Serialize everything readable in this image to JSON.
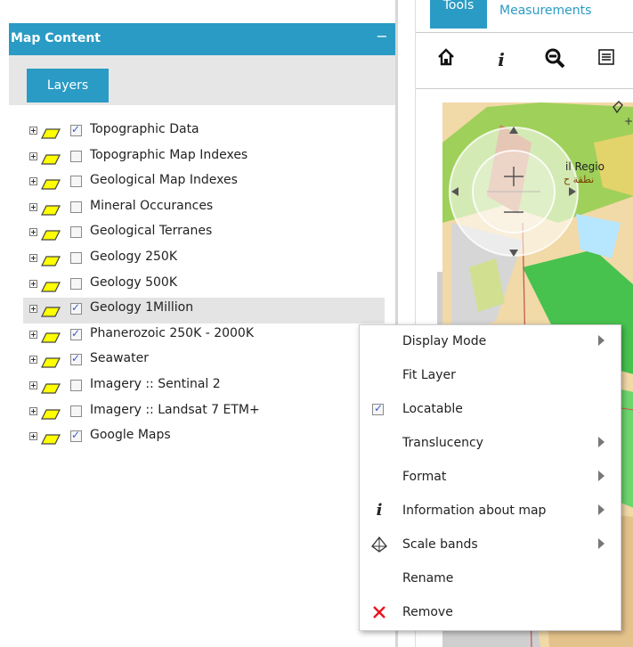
{
  "panel": {
    "title": "Map Content",
    "collapse_symbol": "−",
    "tab_layers": "Layers"
  },
  "layers": [
    {
      "label": "Topographic Data",
      "checked": true
    },
    {
      "label": "Topographic Map Indexes",
      "checked": false
    },
    {
      "label": "Geological Map Indexes",
      "checked": false
    },
    {
      "label": "Mineral Occurances",
      "checked": false
    },
    {
      "label": "Geological Terranes",
      "checked": false
    },
    {
      "label": "Geology 250K",
      "checked": false
    },
    {
      "label": "Geology 500K",
      "checked": false
    },
    {
      "label": "Geology 1Million",
      "checked": true,
      "highlighted": true
    },
    {
      "label": "Phanerozoic 250K - 2000K",
      "checked": true
    },
    {
      "label": "Seawater",
      "checked": true
    },
    {
      "label": "Imagery :: Sentinal 2",
      "checked": false
    },
    {
      "label": "Imagery :: Landsat 7 ETM+",
      "checked": false
    },
    {
      "label": "Google Maps",
      "checked": true
    }
  ],
  "right": {
    "tab_tools": "Tools",
    "tab_measurements": "Measurements",
    "map_label_1": "il Regio",
    "map_label_2": "نطقة ح"
  },
  "menu": {
    "display_mode": "Display Mode",
    "fit_layer": "Fit Layer",
    "locatable": "Locatable",
    "translucency": "Translucency",
    "format": "Format",
    "information": "Information about map",
    "scale_bands": "Scale bands",
    "rename": "Rename",
    "remove": "Remove"
  },
  "colors": {
    "accent": "#2a9bc4",
    "layer_icon_fill": "#ffff00",
    "layer_icon_stroke": "#444444",
    "remove_icon": "#e8141b"
  }
}
